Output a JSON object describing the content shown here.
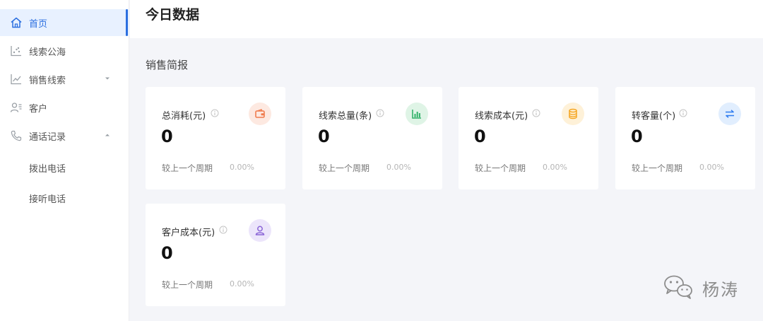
{
  "sidebar": {
    "items": [
      {
        "label": "首页",
        "icon": "home-icon"
      },
      {
        "label": "线索公海",
        "icon": "scatter-icon"
      },
      {
        "label": "销售线索",
        "icon": "line-chart-icon"
      },
      {
        "label": "客户",
        "icon": "user-card-icon"
      },
      {
        "label": "通话记录",
        "icon": "phone-icon"
      }
    ],
    "sub_items": [
      {
        "label": "拨出电话"
      },
      {
        "label": "接听电话"
      }
    ]
  },
  "header": {
    "title": "今日数据"
  },
  "section": {
    "title": "销售简报"
  },
  "cards": [
    {
      "label": "总消耗(元)",
      "value": "0",
      "compare": "较上一个周期",
      "pct": "0.00%",
      "icon": "wallet-icon",
      "icon_bg": "#fde9e1",
      "icon_color": "#f07c4e"
    },
    {
      "label": "线索总量(条)",
      "value": "0",
      "compare": "较上一个周期",
      "pct": "0.00%",
      "icon": "bar-chart-icon",
      "icon_bg": "#dff4e6",
      "icon_color": "#33b26a"
    },
    {
      "label": "线索成本(元)",
      "value": "0",
      "compare": "较上一个周期",
      "pct": "0.00%",
      "icon": "coins-icon",
      "icon_bg": "#fef1d8",
      "icon_color": "#f5a623"
    },
    {
      "label": "转客量(个)",
      "value": "0",
      "compare": "较上一个周期",
      "pct": "0.00%",
      "icon": "swap-icon",
      "icon_bg": "#e1eefe",
      "icon_color": "#2f7cf0"
    },
    {
      "label": "客户成本(元)",
      "value": "0",
      "compare": "较上一个周期",
      "pct": "0.00%",
      "icon": "person-icon",
      "icon_bg": "#ece5fb",
      "icon_color": "#8a64d6"
    }
  ],
  "watermark": {
    "text": "杨涛",
    "icon": "wechat-icon"
  }
}
